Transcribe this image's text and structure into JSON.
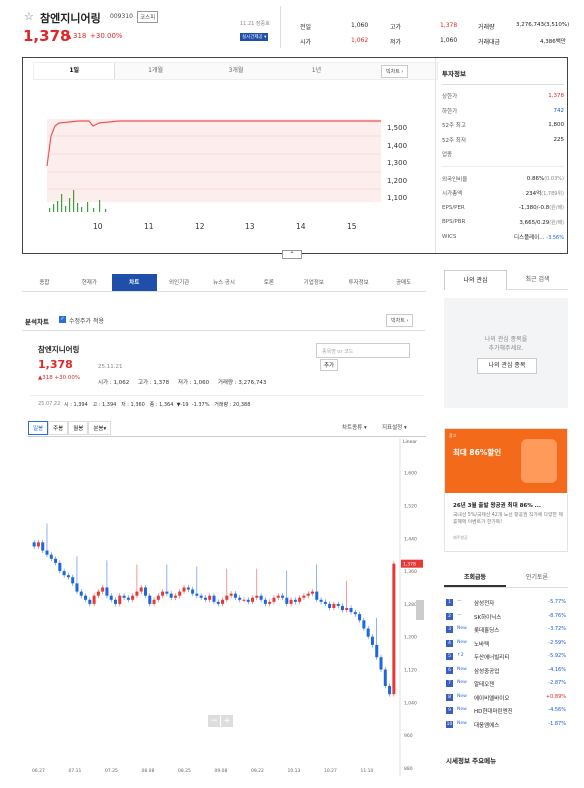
{
  "header": {
    "star_icon": "star-outline-icon",
    "name": "참엔지니어링",
    "code": "009310",
    "market": "코스피",
    "price": "1,378",
    "change_arrow": "▲",
    "change": "318",
    "change_pct": "+30.00%",
    "time": "11.21 장중호",
    "realtime": "실시간제공 ▾",
    "stats": {
      "prev_label": "전일",
      "prev_value": "1,060",
      "open_label": "시가",
      "open_value": "1,062",
      "high_label": "고가",
      "high_value": "1,378",
      "low_label": "저가",
      "low_value": "1,060",
      "volume_label": "거래량",
      "volume_value": "3,276,743(3,510%)",
      "amount_label": "거래대금",
      "amount_value": "4,386백만"
    }
  },
  "top_chart": {
    "tabs": [
      "1일",
      "1개월",
      "3개월",
      "1년",
      "3년"
    ],
    "big_chart_button": "빅차트 ›",
    "y_ticks": [
      "1,500",
      "1,400",
      "1,300",
      "1,200",
      "1,100"
    ],
    "x_ticks": [
      "10",
      "11",
      "12",
      "13",
      "14",
      "15"
    ],
    "expand_icon": "chevron-up-icon"
  },
  "invest_info": {
    "title": "투자정보",
    "rows": [
      {
        "label": "상한가",
        "value": "1,378",
        "tone": "red"
      },
      {
        "label": "하한가",
        "value": "742",
        "tone": "blue"
      },
      {
        "label": "52주 최고",
        "value": "1,800",
        "tone": ""
      },
      {
        "label": "52주 최저",
        "value": "225",
        "tone": ""
      },
      {
        "label": "업종",
        "value": "",
        "tone": ""
      }
    ],
    "rows2": [
      {
        "label": "외국인비율",
        "value": "0.86%",
        "sub": "(0.03%)"
      },
      {
        "label": "시가총액",
        "value": "234억",
        "sub": "(1,789위)"
      },
      {
        "label": "EPS/PER",
        "value": "-1,380/-0.8",
        "sub": "(원/배)"
      },
      {
        "label": "BPS/PBR",
        "value": "3,665/0.29",
        "sub": "(원/배)"
      },
      {
        "label": "WICS",
        "value": "디스플레이...",
        "sub": "-3.56%"
      }
    ]
  },
  "main_tabs": [
    "종합",
    "현재가",
    "차트",
    "외인기관",
    "뉴스·공시",
    "토론",
    "기업정보",
    "투자정보",
    "공매도"
  ],
  "analysis": {
    "title": "분석차트",
    "adjusted_label": "수정주가 적용",
    "big_chart_button": "빅차트 ›",
    "stock_name": "참엔지니어링",
    "price": "1,378",
    "date": "25.11.21",
    "change": "▲318 +30.00%",
    "stats_line1": "시가 : 1,062     고가 : 1,378     저가 : 1,060     거래량 : 3,276,743",
    "search_placeholder": "종목명 or 코드",
    "add_button": "추가",
    "hover_line_date": "25.07.22",
    "hover_line": "시 : 1,394   고 : 1,394   저 : 1,360   종 : 1,364  ▼-19  -1.37%   거래량 : 20,388",
    "period_tabs": [
      "일봉",
      "주봉",
      "월봉",
      "분봉▾"
    ],
    "chart_type_label": "차트종류 ▾",
    "indicator_label": "지표설정 ▾",
    "linear_label": "Linear",
    "zoom_minus": "−",
    "zoom_plus": "+"
  },
  "chart_data": {
    "type": "candlestick",
    "y_ticks": [
      "1,600",
      "1,520",
      "1,440",
      "1,360",
      "1,280",
      "1,200",
      "1,120",
      "1,040",
      "960",
      "880"
    ],
    "x_ticks": [
      "06.27",
      "07.11",
      "07.25",
      "08.08",
      "08.25",
      "09.08",
      "09.22",
      "10.13",
      "10.27",
      "11.10"
    ],
    "ylim": [
      880,
      1660
    ],
    "last_price_label": "1,378",
    "closes": [
      1420,
      1430,
      1410,
      1400,
      1390,
      1380,
      1360,
      1350,
      1345,
      1330,
      1310,
      1300,
      1290,
      1280,
      1300,
      1310,
      1320,
      1300,
      1290,
      1280,
      1300,
      1295,
      1290,
      1300,
      1310,
      1320,
      1300,
      1280,
      1290,
      1300,
      1310,
      1305,
      1295,
      1300,
      1310,
      1320,
      1315,
      1305,
      1300,
      1295,
      1290,
      1300,
      1285,
      1280,
      1290,
      1300,
      1305,
      1295,
      1290,
      1290,
      1285,
      1295,
      1300,
      1290,
      1280,
      1285,
      1295,
      1300,
      1295,
      1280,
      1290,
      1285,
      1295,
      1300,
      1305,
      1310,
      1290,
      1285,
      1280,
      1270,
      1280,
      1275,
      1265,
      1270,
      1260,
      1255,
      1240,
      1220,
      1200,
      1180,
      1150,
      1120,
      1080,
      1060,
      1378
    ]
  },
  "right": {
    "tabs": [
      "나의 관심",
      "최근 검색"
    ],
    "interest_msg1": "나의 관심 종목을",
    "interest_msg2": "추가해주세요.",
    "interest_button": "나의 관심 종목",
    "ad_tag": "광고",
    "ad_big": "최대 86%할인",
    "ad_title": "26년 3월 출발 왕공권 최대 86% ...",
    "ad_desc": "국내선 5%/국제선 42개 노선 항공권 직가에 다양한 제휴혜택 이벤트가 한가득!",
    "ad_footer": "제주항공",
    "rank_tabs": [
      "조회급등",
      "인기토론"
    ],
    "rank_items": [
      {
        "num": "1",
        "badge": "—",
        "name": "삼성전자",
        "pct": "-5.77%"
      },
      {
        "num": "2",
        "badge": "—",
        "name": "SK하이닉스",
        "pct": "-8.76%"
      },
      {
        "num": "3",
        "badge": "New",
        "name": "롯데홀딩스",
        "pct": "-3.72%"
      },
      {
        "num": "4",
        "badge": "New",
        "name": "노바텍",
        "pct": "-2.59%"
      },
      {
        "num": "5",
        "badge": "↑2",
        "name": "두산에너빌리티",
        "pct": "-5.92%"
      },
      {
        "num": "6",
        "badge": "New",
        "name": "삼성중공업",
        "pct": "-4.16%"
      },
      {
        "num": "7",
        "badge": "New",
        "name": "알테오젠",
        "pct": "-2.87%"
      },
      {
        "num": "8",
        "badge": "New",
        "name": "에이비엘바이오",
        "pct": "+0.89%"
      },
      {
        "num": "9",
        "badge": "New",
        "name": "HD현대마린엔진",
        "pct": "-4.56%"
      },
      {
        "num": "10",
        "badge": "New",
        "name": "대웅엠에스",
        "pct": "-1.87%"
      }
    ],
    "bottom_title": "시세정보 주요메뉴"
  }
}
